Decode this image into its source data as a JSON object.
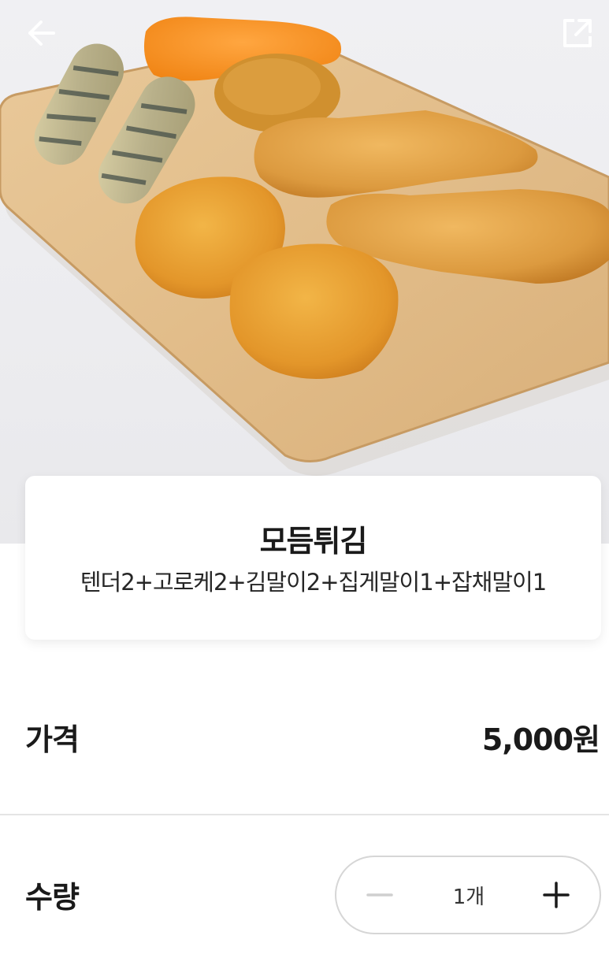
{
  "header": {
    "back_icon": "arrow-left-icon",
    "share_icon": "share-external-icon"
  },
  "product": {
    "name": "모듬튀김",
    "description": "텐더2+고로케2+김말이2+집게말이1+잡채말이1",
    "photo": "fried-food-on-wooden-board"
  },
  "price": {
    "label": "가격",
    "value": "5,000원"
  },
  "quantity": {
    "label": "수량",
    "value": "1개",
    "minus_icon": "minus-icon",
    "plus_icon": "plus-icon"
  },
  "colors": {
    "text": "#1a1a1a",
    "divider": "#e4e4e4",
    "stepper_border": "#d6d6d6",
    "minus_disabled": "#cfcfcf"
  }
}
